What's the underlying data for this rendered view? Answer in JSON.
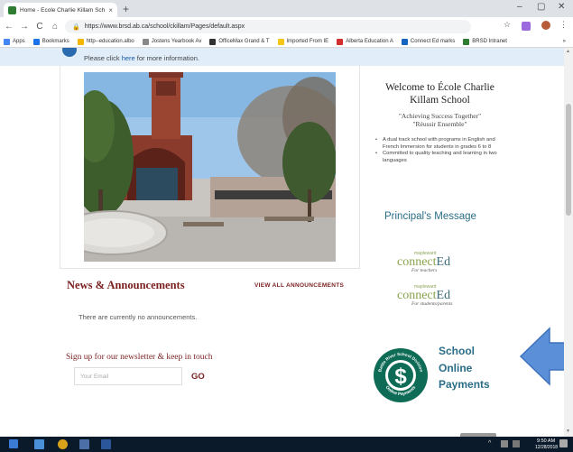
{
  "browser": {
    "tab_title": "Home - Ecole Charlie Killam Sch",
    "tab_close": "×",
    "new_tab": "+",
    "url": "https://www.brsd.ab.ca/school/ckillam/Pages/default.aspx",
    "window_controls": [
      "–",
      "▢",
      "✕"
    ],
    "nav": {
      "back": "←",
      "forward": "→",
      "reload": "C",
      "home": "⌂"
    },
    "star": "☆",
    "menu": "⋮",
    "bookmarks": [
      {
        "label": "Apps",
        "color": "#4285f4"
      },
      {
        "label": "Bookmarks",
        "color": "#1a73e8"
      },
      {
        "label": "http--education.albo",
        "color": "#f4b400"
      },
      {
        "label": "Jostens Yearbook Av",
        "color": "#888888"
      },
      {
        "label": "OfficeMax Grand & T",
        "color": "#333333"
      },
      {
        "label": "Imported From IE",
        "color": "#f5c518"
      },
      {
        "label": "Alberta Education A",
        "color": "#d32f2f"
      },
      {
        "label": "Connect Ed marks",
        "color": "#1565c0"
      },
      {
        "label": "BRSD Intranet",
        "color": "#2e7d32"
      }
    ],
    "bookmarks_overflow": "»"
  },
  "notice": {
    "text_before": "Please click ",
    "link": "here",
    "text_after": " for more information."
  },
  "welcome": {
    "title": "Welcome to École Charlie Killam School",
    "motto_1": "\"Achieving Success Together\"",
    "motto_2": "\"Réussir Ensemble\"",
    "bullets": [
      "A dual track school with programs in English and French Immersion for students in grades 6 to 8",
      "Committed to quality teaching and learning in two languages"
    ]
  },
  "principal": {
    "label": "Principal's Message"
  },
  "connected_teachers": {
    "maple": "mapleward",
    "connect": "connect",
    "ed": "Ed",
    "sub": "For teachers"
  },
  "connected_students": {
    "maple": "mapleward",
    "connect": "connect",
    "ed": "Ed",
    "sub": "For students/parents"
  },
  "news": {
    "title": "News & Announcements",
    "view_all": "VIEW ALL ANNOUNCEMENTS",
    "empty": "There are currently no announcements."
  },
  "newsletter": {
    "title": "Sign up for our newsletter & keep in touch",
    "placeholder": "Your Email",
    "go": "GO"
  },
  "payments": {
    "line1": "School",
    "line2": "Online",
    "line3": "Payments",
    "seal_top": "Battle River School Division",
    "seal_bottom": "Online Payments",
    "seal_symbol": "$"
  },
  "taskbar": {
    "time": "9:50 AM",
    "date": "12/28/2018",
    "tray": "^"
  },
  "colors": {
    "accent_maroon": "#7a1f1f",
    "accent_teal": "#2a6d87",
    "notice_bg": "#e1eef9",
    "arrow_blue": "#5b8fd8"
  }
}
